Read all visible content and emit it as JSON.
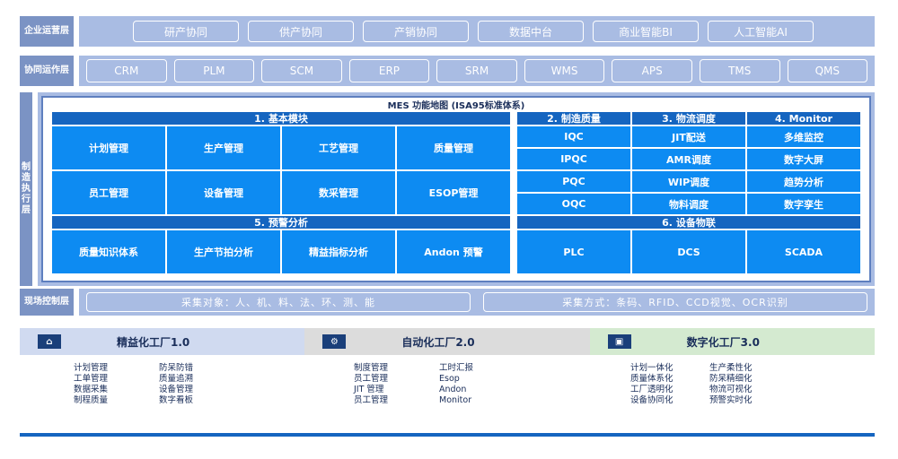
{
  "layers": {
    "enterprise": {
      "label": "企业运营层",
      "items": [
        "研产协同",
        "供产协同",
        "产销协同",
        "数据中台",
        "商业智能BI",
        "人工智能AI"
      ]
    },
    "collab": {
      "label": "协同运作层",
      "items": [
        "CRM",
        "PLM",
        "SCM",
        "ERP",
        "SRM",
        "WMS",
        "APS",
        "TMS",
        "QMS"
      ]
    },
    "manufacturing": {
      "label": "制造执行层"
    },
    "field": {
      "label": "现场控制层",
      "collect_objects": "采集对象：人、机、料、法、环、测、能",
      "collect_methods": "采集方式：条码、RFID、CCD视觉、OCR识别"
    }
  },
  "mes": {
    "title": "MES 功能地图 (ISA95标准体系)",
    "sec1": {
      "title": "1. 基本模块",
      "items": [
        "计划管理",
        "生产管理",
        "工艺管理",
        "质量管理",
        "员工管理",
        "设备管理",
        "数采管理",
        "ESOP管理"
      ]
    },
    "sec2": {
      "title": "2. 制造质量",
      "items": [
        "IQC",
        "IPQC",
        "PQC",
        "OQC"
      ]
    },
    "sec3": {
      "title": "3. 物流调度",
      "items": [
        "JIT配送",
        "AMR调度",
        "WIP调度",
        "物料调度"
      ]
    },
    "sec4": {
      "title": "4. Monitor",
      "items": [
        "多维监控",
        "数字大屏",
        "趋势分析",
        "数字孪生"
      ]
    },
    "sec5": {
      "title": "5. 预警分析",
      "items": [
        "质量知识体系",
        "生产节拍分析",
        "精益指标分析",
        "Andon 预警"
      ]
    },
    "sec6": {
      "title": "6. 设备物联",
      "items": [
        "PLC",
        "DCS",
        "SCADA"
      ]
    }
  },
  "factories": [
    {
      "title": "精益化工厂1.0",
      "icon": "factory-icon"
    },
    {
      "title": "自动化工厂2.0",
      "icon": "robot-icon"
    },
    {
      "title": "数字化工厂3.0",
      "icon": "screen-icon"
    }
  ],
  "lists": {
    "f1a": [
      "计划管理",
      "工单管理",
      "数据采集",
      "制程质量"
    ],
    "f1b": [
      "防呆防错",
      "质量追溯",
      "设备管理",
      "数字看板"
    ],
    "f2a": [
      "制度管理",
      "员工管理",
      "JIT 管理",
      "员工管理"
    ],
    "f2b": [
      "工时汇报",
      "Esop",
      "Andon",
      "Monitor"
    ],
    "f3a": [
      "计划一体化",
      "质量体系化",
      "工厂透明化",
      "设备协同化"
    ],
    "f3b": [
      "生产柔性化",
      "防呆精细化",
      "物流可视化",
      "预警实时化"
    ]
  },
  "colors": {
    "accent": "#1565c0",
    "cell": "#0d8bf2",
    "layer": "#a9bce3"
  }
}
